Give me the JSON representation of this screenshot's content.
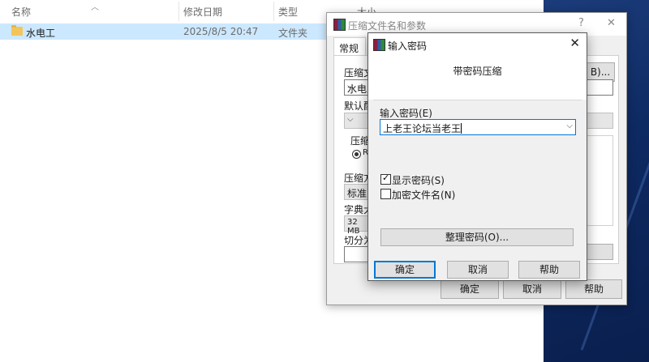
{
  "explorer": {
    "columns": {
      "name": "名称",
      "modified": "修改日期",
      "type": "类型",
      "size": "大小"
    },
    "rows": [
      {
        "name": "水电工",
        "modified": "2025/8/5 20:47",
        "type": "文件夹"
      }
    ]
  },
  "archive_dialog": {
    "title": "压缩文件名和参数",
    "help_glyph": "?",
    "close_glyph": "✕",
    "tab_general": "常规",
    "archive_name_label": "压缩文",
    "archive_name_value": "水电工",
    "browse_button_tail": "B)...",
    "default_profile_label": "默认配",
    "format_group_label": "压缩",
    "format_radio_label": "RA",
    "method_label": "压缩方",
    "method_value": "标准",
    "dict_label": "字典大",
    "dict_value": "32 MB",
    "split_label": "切分为",
    "ok": "确定",
    "cancel": "取消",
    "help": "帮助"
  },
  "password_dialog": {
    "title": "输入密码",
    "heading": "带密码压缩",
    "password_label": "输入密码(E)",
    "password_value": "上老王论坛当老王",
    "show_password_label": "显示密码(S)",
    "show_password_checked": true,
    "encrypt_names_label": "加密文件名(N)",
    "encrypt_names_checked": false,
    "organize_button": "整理密码(O)...",
    "ok": "确定",
    "cancel": "取消",
    "help": "帮助"
  }
}
